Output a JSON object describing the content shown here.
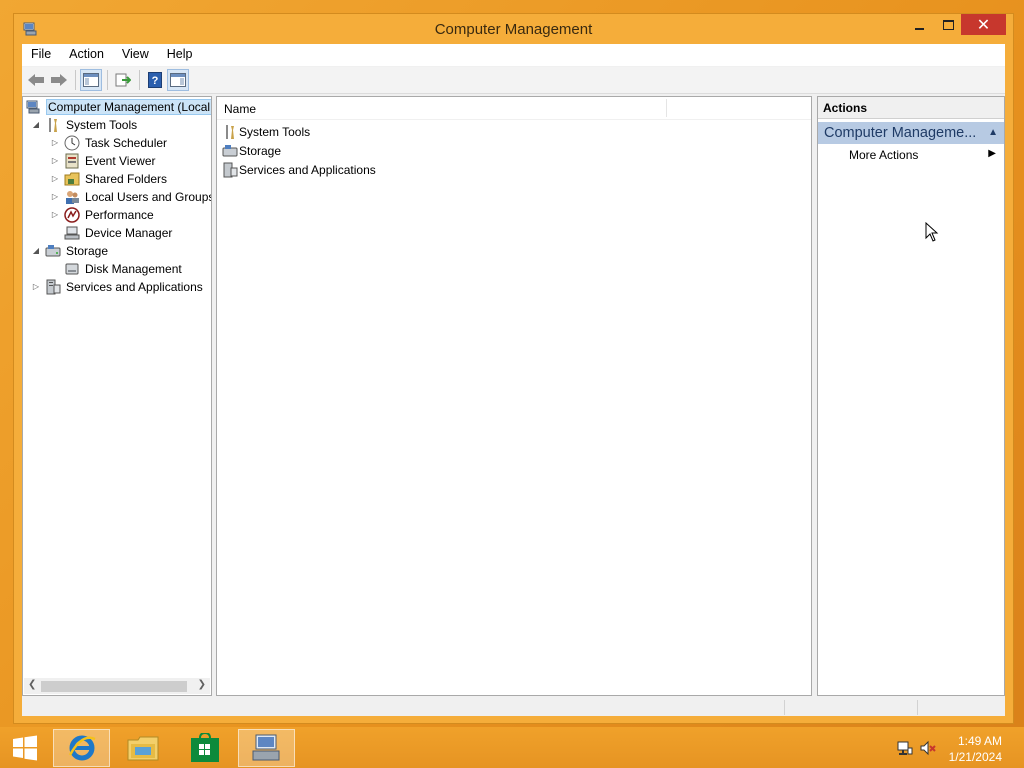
{
  "window": {
    "title": "Computer Management",
    "close_glyph": "✕"
  },
  "menu": [
    "File",
    "Action",
    "View",
    "Help"
  ],
  "tree": {
    "root": "Computer Management (Local",
    "system_tools": "System Tools",
    "task_scheduler": "Task Scheduler",
    "event_viewer": "Event Viewer",
    "shared_folders": "Shared Folders",
    "local_users": "Local Users and Groups",
    "performance": "Performance",
    "device_manager": "Device Manager",
    "storage": "Storage",
    "disk_management": "Disk Management",
    "services_apps": "Services and Applications"
  },
  "list": {
    "column_name": "Name",
    "items": [
      "System Tools",
      "Storage",
      "Services and Applications"
    ]
  },
  "actions": {
    "header": "Actions",
    "section": "Computer Manageme...",
    "more_actions": "More Actions"
  },
  "taskbar": {
    "time": "1:49 AM",
    "date": "1/21/2024"
  },
  "colors": {
    "accent": "#f5ad3a",
    "close": "#c7372d",
    "actions_section": "#b7cae3"
  }
}
